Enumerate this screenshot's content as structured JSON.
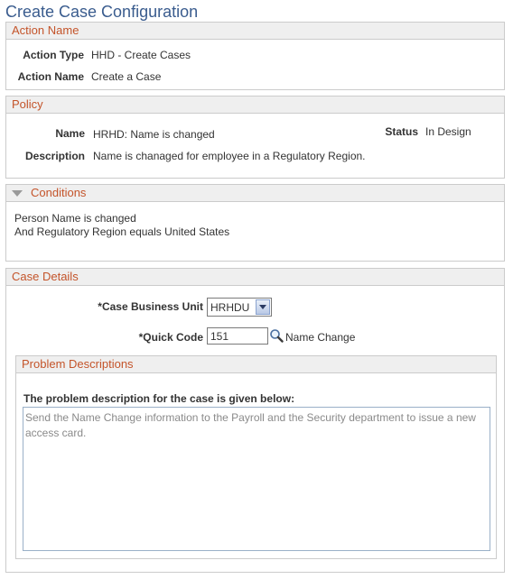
{
  "page": {
    "title": "Create Case Configuration"
  },
  "action_name_section": {
    "header": "Action Name",
    "action_type_label": "Action Type",
    "action_type_value": "HHD - Create Cases",
    "action_name_label": "Action Name",
    "action_name_value": "Create a Case"
  },
  "policy_section": {
    "header": "Policy",
    "name_label": "Name",
    "name_value": "HRHD: Name is changed",
    "status_label": "Status",
    "status_value": "In Design",
    "description_label": "Description",
    "description_value": "Name is chanaged for employee in a Regulatory Region."
  },
  "conditions_section": {
    "header": "Conditions",
    "line1": "Person Name is changed",
    "line2": "And Regulatory Region equals United States"
  },
  "case_details_section": {
    "header": "Case Details",
    "business_unit_label": "*Case Business Unit",
    "business_unit_value": "HRHDU",
    "quick_code_label": "*Quick Code",
    "quick_code_value": "151",
    "quick_code_description": "Name Change",
    "problem_descriptions": {
      "header": "Problem Descriptions",
      "prompt": "The problem description for the case is given below:",
      "text": "Send the Name Change information to the Payroll and the Security department to issue a new access card."
    }
  },
  "colors": {
    "title": "#3a5c8e",
    "section_header_text": "#c4542a",
    "section_header_bg": "#efefef",
    "border": "#cbcbcb"
  }
}
